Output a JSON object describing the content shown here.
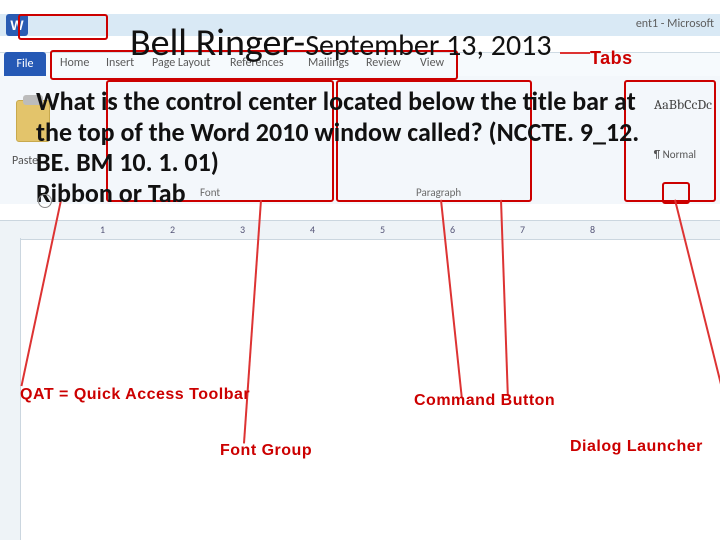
{
  "heading": {
    "mainA": "Bell Ringer-",
    "mainB": "September 13, 2013"
  },
  "question": "What is the control center located below the title bar at the top of the Word 2010 window called? (NCCTE. 9_12. BE. BM 10. 1. 01)",
  "answer": "Ribbon or Tab",
  "word_ui": {
    "doc_title": "ent1 - Microsoft",
    "file_tab": "File",
    "tabs": {
      "home": "Home",
      "insert": "Insert",
      "page": "Page Layout",
      "ref": "References",
      "mail": "Mailings",
      "review": "Review",
      "view": "View"
    },
    "paste": "Paste",
    "group_font": "Font",
    "group_para": "Paragraph",
    "style_sample": "AaBbCcDc",
    "style_normal": "¶ Normal"
  },
  "callouts": {
    "tabs": "Tabs",
    "qat": "QAT = Quick Access Toolbar",
    "font_group": "Font Group",
    "command_button": "Command Button",
    "dialog_launcher": "Dialog Launcher"
  },
  "ruler": {
    "m1": "1",
    "m2": "2",
    "m3": "3",
    "m4": "4",
    "m5": "5",
    "m6": "6",
    "m7": "7",
    "m8": "8"
  },
  "icons": {
    "word_logo": "W"
  }
}
